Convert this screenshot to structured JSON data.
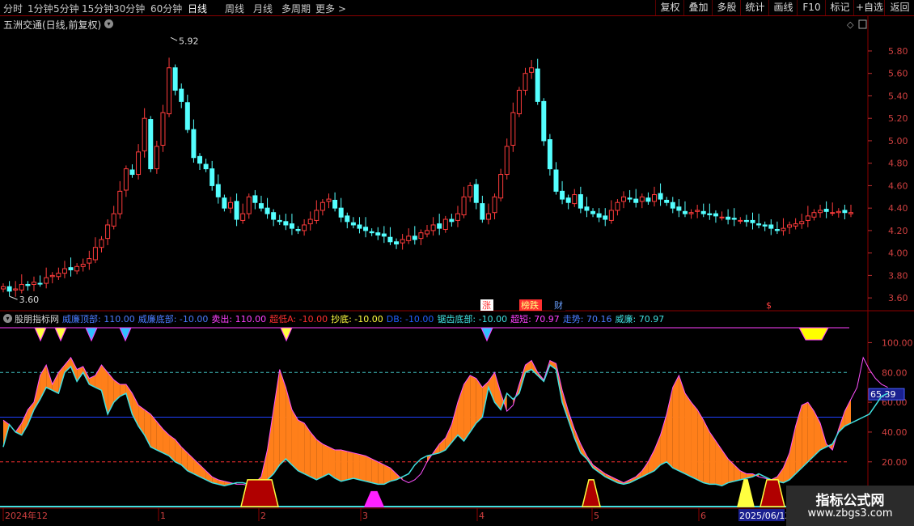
{
  "toolbar": {
    "periods": [
      "分时",
      "1分钟",
      "5分钟",
      "15分钟",
      "30分钟",
      "60分钟",
      "日线",
      "周线",
      "月线",
      "多周期",
      "更多 >"
    ],
    "active_period": "日线",
    "right_buttons": [
      "复权",
      "叠加",
      "多股",
      "统计",
      "画线",
      "F10",
      "标记",
      "+自选",
      "返回"
    ]
  },
  "price_panel": {
    "title": "五洲交通(日线,前复权)",
    "high_mark": "5.92",
    "low_mark": "3.60",
    "axis_labels": [
      "5.80",
      "5.60",
      "5.40",
      "5.20",
      "5.00",
      "4.80",
      "4.60",
      "4.40",
      "4.20",
      "4.00",
      "3.80",
      "3.60"
    ],
    "event_markers": [
      "涨",
      "榜跌",
      "财",
      "$"
    ]
  },
  "indicator_panel": {
    "name": "股朋指标网",
    "legend": [
      {
        "label": "威廉顶部: 110.00",
        "color": "#4a7cff"
      },
      {
        "label": "威廉底部: -10.00",
        "color": "#4a7cff"
      },
      {
        "label": "卖出: 110.00",
        "color": "#ff40ff"
      },
      {
        "label": "超低A: -10.00",
        "color": "#ff3030"
      },
      {
        "label": "抄底: -10.00",
        "color": "#ffff40"
      },
      {
        "label": "DB: -10.00",
        "color": "#2060ff"
      },
      {
        "label": "锯齿底部: -10.00",
        "color": "#40e0e0"
      },
      {
        "label": "超短: 70.97",
        "color": "#ff40ff"
      },
      {
        "label": "走势: 70.16",
        "color": "#4a7cff"
      },
      {
        "label": "威廉: 70.97",
        "color": "#40e0e0"
      }
    ],
    "axis_labels": [
      "100.00",
      "80.00",
      "60.00",
      "40.00",
      "20.00"
    ],
    "current_value": "65.39"
  },
  "time_axis": {
    "labels": [
      "2024年12",
      "1",
      "2",
      "3",
      "4",
      "5",
      "6"
    ],
    "cursor_label": "2025/06/13"
  },
  "watermark": {
    "line1": "指标公式网",
    "line2": "www.zbgs3.com"
  },
  "chart_data": {
    "type": "candlestick",
    "price_axis_ticks": [
      3.6,
      3.8,
      4.0,
      4.2,
      4.4,
      4.6,
      4.8,
      5.0,
      5.2,
      5.4,
      5.6,
      5.8
    ],
    "price_ylim": [
      3.5,
      5.98
    ],
    "closes": [
      3.7,
      3.66,
      3.68,
      3.72,
      3.71,
      3.74,
      3.73,
      3.78,
      3.8,
      3.82,
      3.86,
      3.85,
      3.88,
      3.9,
      3.95,
      4.05,
      4.12,
      4.25,
      4.35,
      4.55,
      4.75,
      4.7,
      4.9,
      5.2,
      4.75,
      4.95,
      5.25,
      5.65,
      5.45,
      5.35,
      5.1,
      4.85,
      4.8,
      4.75,
      4.6,
      4.5,
      4.4,
      4.45,
      4.3,
      4.35,
      4.5,
      4.45,
      4.4,
      4.35,
      4.3,
      4.28,
      4.25,
      4.22,
      4.2,
      4.25,
      4.3,
      4.38,
      4.45,
      4.48,
      4.4,
      4.32,
      4.28,
      4.25,
      4.22,
      4.2,
      4.18,
      4.16,
      4.15,
      4.1,
      4.08,
      4.12,
      4.15,
      4.12,
      4.18,
      4.2,
      4.25,
      4.22,
      4.3,
      4.28,
      4.35,
      4.5,
      4.6,
      4.45,
      4.3,
      4.35,
      4.5,
      4.7,
      4.95,
      5.25,
      5.45,
      5.6,
      5.65,
      5.35,
      5.0,
      4.75,
      4.55,
      4.48,
      4.45,
      4.52,
      4.4,
      4.38,
      4.35,
      4.32,
      4.3,
      4.38,
      4.45,
      4.5,
      4.48,
      4.45,
      4.5,
      4.46,
      4.52,
      4.48,
      4.45,
      4.4,
      4.38,
      4.35,
      4.36,
      4.38,
      4.35,
      4.34,
      4.33,
      4.32,
      4.3,
      4.3,
      4.29,
      4.28,
      4.27,
      4.25,
      4.24,
      4.22,
      4.2,
      4.22,
      4.25,
      4.26,
      4.28,
      4.33,
      4.36,
      4.38,
      4.37,
      4.36,
      4.37,
      4.36,
      4.36
    ],
    "indicator_ylim": [
      -10,
      110
    ],
    "indicator_ref_lines": [
      110,
      80,
      50,
      20,
      -10
    ],
    "series": [
      {
        "name": "超短",
        "values": [
          48,
          45,
          40,
          46,
          55,
          60,
          78,
          85,
          72,
          80,
          85,
          90,
          82,
          84,
          76,
          78,
          85,
          80,
          75,
          72,
          72,
          66,
          58,
          55,
          52,
          47,
          42,
          38,
          35,
          30,
          26,
          22,
          18,
          14,
          10,
          8,
          7,
          6,
          5,
          5,
          4,
          6,
          10,
          28,
          55,
          82,
          70,
          55,
          48,
          46,
          40,
          35,
          32,
          30,
          28,
          28,
          27,
          26,
          25,
          24,
          22,
          20,
          18,
          16,
          12,
          8,
          6,
          8,
          12,
          20,
          26,
          32,
          36,
          45,
          60,
          72,
          78,
          76,
          70,
          74,
          80,
          66,
          54,
          58,
          72,
          85,
          88,
          80,
          75,
          88,
          86,
          68,
          54,
          42,
          32,
          24,
          18,
          15,
          12,
          10,
          8,
          6,
          8,
          10,
          14,
          20,
          28,
          38,
          52,
          70,
          78,
          66,
          60,
          55,
          48,
          40,
          34,
          28,
          22,
          18,
          14,
          12,
          12,
          10,
          9,
          8,
          10,
          16,
          26,
          44,
          58,
          60,
          54,
          46,
          32,
          28,
          42,
          54,
          62,
          70,
          90,
          82,
          76,
          72,
          70
        ]
      },
      {
        "name": "威廉",
        "values": [
          30,
          45,
          40,
          38,
          45,
          55,
          62,
          70,
          68,
          66,
          80,
          84,
          74,
          80,
          72,
          70,
          68,
          52,
          60,
          64,
          66,
          52,
          44,
          38,
          30,
          28,
          26,
          24,
          20,
          18,
          14,
          12,
          10,
          8,
          6,
          5,
          4,
          5,
          6,
          6,
          5,
          5,
          6,
          8,
          12,
          18,
          22,
          18,
          14,
          12,
          10,
          8,
          10,
          12,
          9,
          7,
          8,
          9,
          8,
          7,
          6,
          5,
          5,
          7,
          8,
          10,
          12,
          18,
          22,
          24,
          25,
          26,
          28,
          33,
          38,
          34,
          40,
          46,
          50,
          70,
          60,
          55,
          66,
          62,
          66,
          80,
          82,
          78,
          74,
          85,
          82,
          60,
          48,
          36,
          26,
          22,
          16,
          13,
          10,
          8,
          6,
          5,
          6,
          8,
          10,
          12,
          14,
          18,
          20,
          16,
          14,
          12,
          10,
          8,
          6,
          5,
          5,
          4,
          6,
          7,
          8,
          9,
          10,
          12,
          10,
          8,
          7,
          6,
          8,
          12,
          16,
          20,
          24,
          28,
          30,
          32,
          40,
          44,
          46,
          48,
          50,
          52,
          58,
          64,
          66
        ]
      }
    ]
  }
}
